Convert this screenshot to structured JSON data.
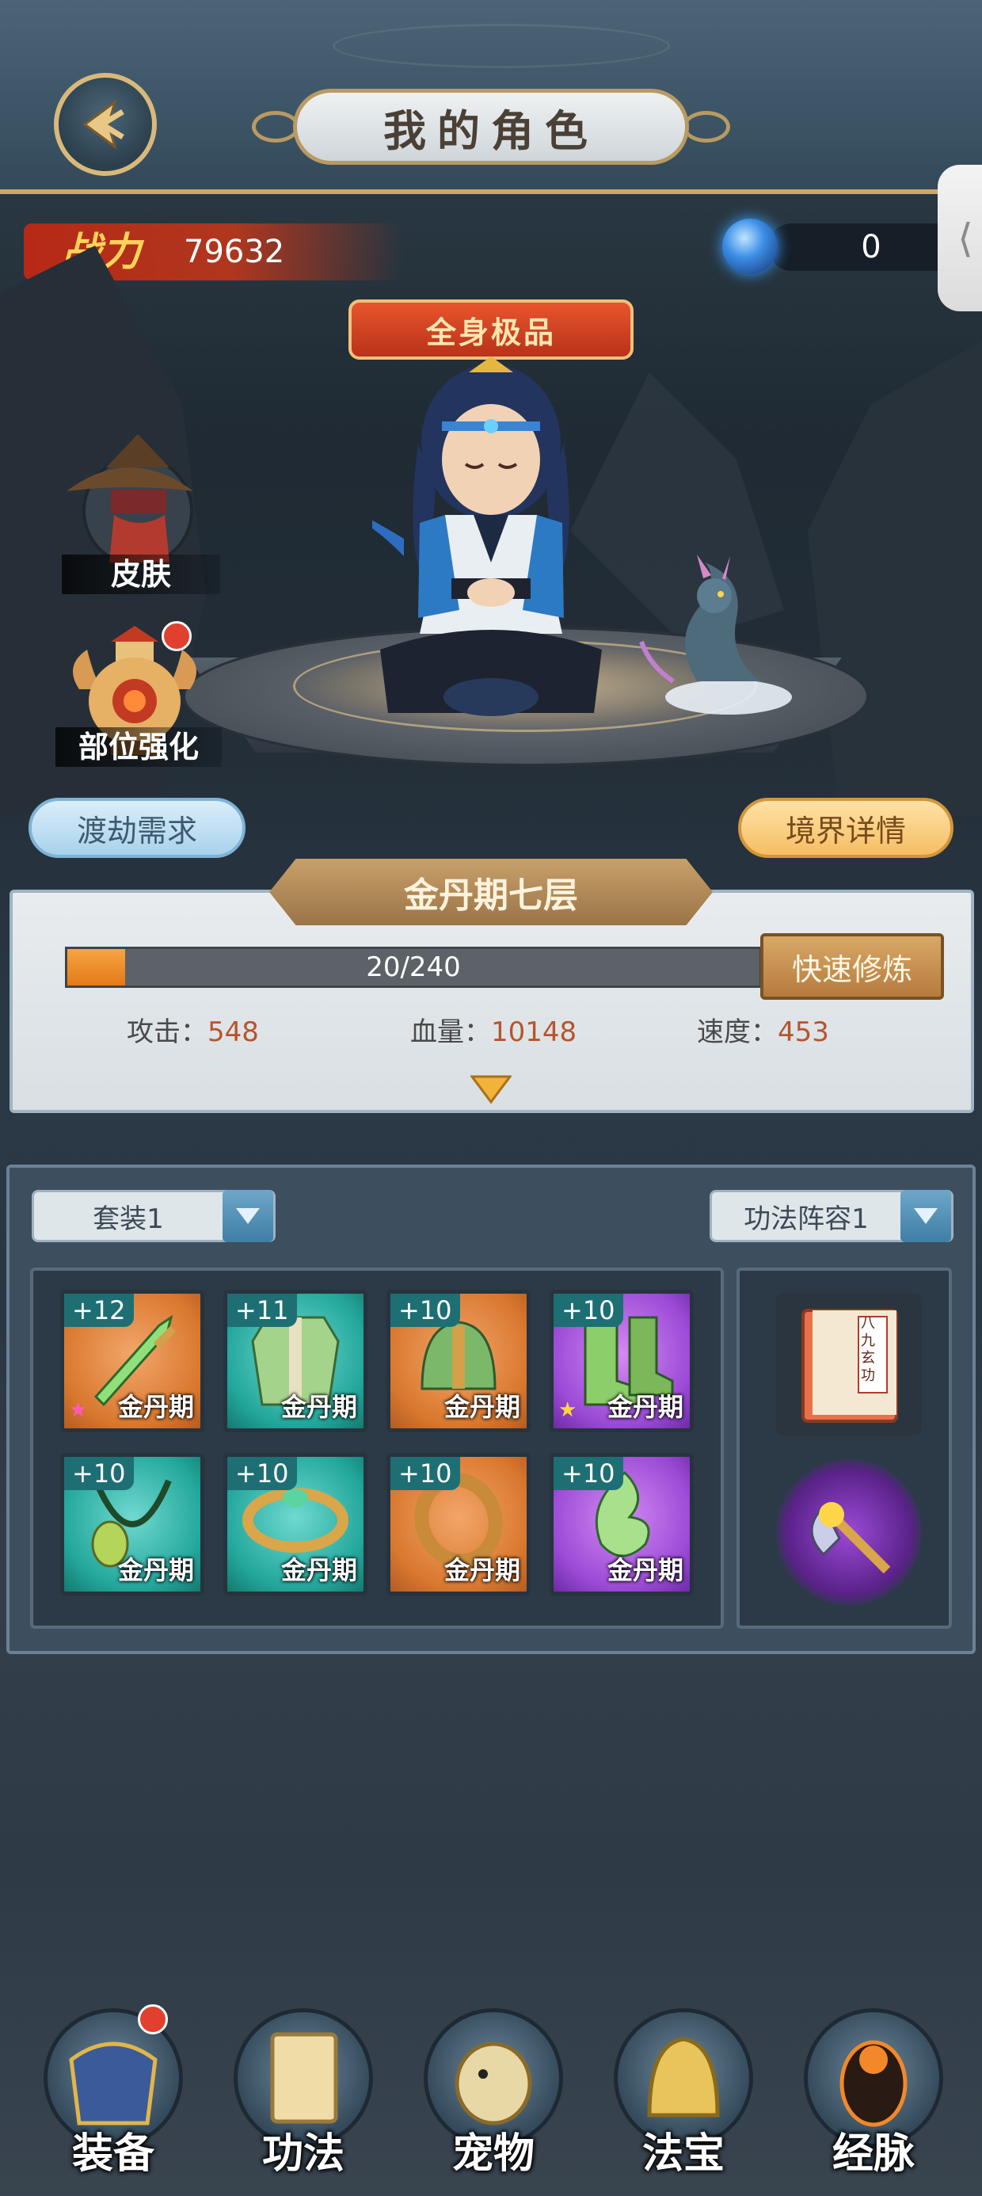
{
  "header": {
    "title": "我的角色"
  },
  "power": {
    "label": "战力",
    "value": "79632"
  },
  "currency": {
    "value": "0",
    "icon": "spirit-orb-icon"
  },
  "character": {
    "rank_banner": "全身极品",
    "realm": "金丹期七层"
  },
  "side_buttons": {
    "skin": "皮肤",
    "part_enhance": "部位强化"
  },
  "actions": {
    "tribulation": "渡劫需求",
    "realm_details": "境界详情",
    "quick_cultivate": "快速修炼"
  },
  "progress": {
    "text": "20/240",
    "current": 20,
    "max": 240
  },
  "stats": [
    {
      "label": "攻击：",
      "value": "548"
    },
    {
      "label": "血量：",
      "value": "10148"
    },
    {
      "label": "速度：",
      "value": "453"
    }
  ],
  "loadout": {
    "equipment_set": "套装1",
    "skill_set": "功法阵容1"
  },
  "equipment": [
    {
      "level": "+12",
      "realm": "金丹期",
      "quality": "orange",
      "icon": "jade-sword-icon",
      "star": "pink"
    },
    {
      "level": "+11",
      "realm": "金丹期",
      "quality": "teal",
      "icon": "robe-armor-icon",
      "star": ""
    },
    {
      "level": "+10",
      "realm": "金丹期",
      "quality": "orange",
      "icon": "helmet-icon",
      "star": ""
    },
    {
      "level": "+10",
      "realm": "金丹期",
      "quality": "purple",
      "icon": "boots-icon",
      "star": "yellow"
    },
    {
      "level": "+10",
      "realm": "金丹期",
      "quality": "teal",
      "icon": "necklace-icon",
      "star": ""
    },
    {
      "level": "+10",
      "realm": "金丹期",
      "quality": "teal",
      "icon": "bracelet-icon",
      "star": ""
    },
    {
      "level": "+10",
      "realm": "金丹期",
      "quality": "orange",
      "icon": "ring-icon",
      "star": ""
    },
    {
      "level": "+10",
      "realm": "金丹期",
      "quality": "purple",
      "icon": "jade-pendant-icon",
      "star": ""
    }
  ],
  "skill_book": {
    "title": "八九玄功"
  },
  "nav": [
    {
      "label": "装备",
      "icon": "equipment-armor-icon",
      "badge": true
    },
    {
      "label": "功法",
      "icon": "skill-book-icon",
      "badge": false
    },
    {
      "label": "宠物",
      "icon": "pet-dragon-icon",
      "badge": false
    },
    {
      "label": "法宝",
      "icon": "treasure-bell-icon",
      "badge": false
    },
    {
      "label": "经脉",
      "icon": "meridian-icon",
      "badge": false
    }
  ]
}
